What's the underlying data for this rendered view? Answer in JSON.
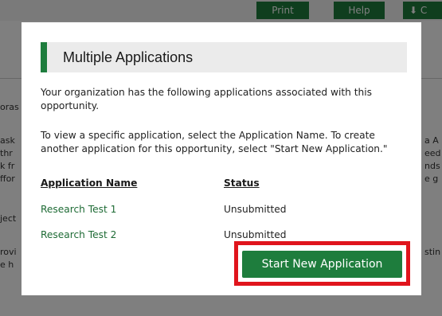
{
  "background": {
    "toolbar": {
      "print_label": "Print",
      "help_label": "Help",
      "extra_label": "⬇ C"
    },
    "fragments": {
      "f1": "oras",
      "f2": "ask",
      "f3": "thr",
      "f4": "k fr",
      "f5": "ffor",
      "f6": "ject",
      "f7": "rovi",
      "f8": "e h",
      "r1": "a A",
      "r2": "eed",
      "r3": "nds",
      "r4": "e g",
      "r5": "stin"
    }
  },
  "modal": {
    "title": "Multiple Applications",
    "intro_text": "Your organization has the following applications associated with this opportunity.",
    "instructions_text": "To view a specific application, select the Application Name. To create another application for this opportunity, select \"Start New Application.\"",
    "columns": {
      "name_header": "Application Name",
      "status_header": "Status"
    },
    "applications": [
      {
        "name": "Research Test 1",
        "status": "Unsubmitted"
      },
      {
        "name": "Research Test 2",
        "status": "Unsubmitted"
      }
    ],
    "start_button_label": "Start New Application",
    "colors": {
      "accent_green": "#1e7d3d",
      "link_green": "#1e6b35",
      "highlight_red": "#e0141c"
    }
  }
}
